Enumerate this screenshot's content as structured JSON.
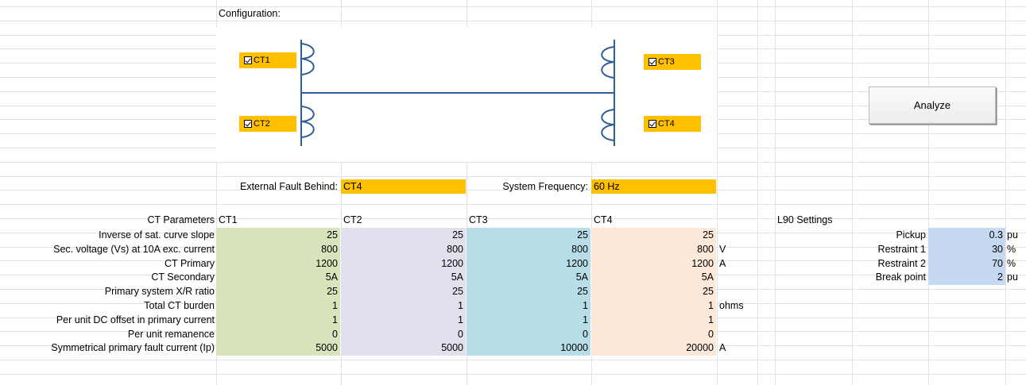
{
  "configuration_label": "Configuration:",
  "cts": [
    {
      "label": "CT1",
      "checked": true
    },
    {
      "label": "CT2",
      "checked": true
    },
    {
      "label": "CT3",
      "checked": true
    },
    {
      "label": "CT4",
      "checked": true
    }
  ],
  "analyze_label": "Analyze",
  "fault": {
    "label": "External Fault Behind:",
    "value": "CT4"
  },
  "frequency": {
    "label": "System Frequency:",
    "value": "60 Hz"
  },
  "params_header": "CT Parameters",
  "ct_columns": [
    "CT1",
    "CT2",
    "CT3",
    "CT4"
  ],
  "rows": [
    {
      "label": "Inverse of sat. curve slope",
      "values": [
        "25",
        "25",
        "25",
        "25"
      ],
      "unit": ""
    },
    {
      "label": "Sec. voltage (Vs) at 10A exc. current",
      "values": [
        "800",
        "800",
        "800",
        "800"
      ],
      "unit": "V"
    },
    {
      "label": "CT Primary",
      "values": [
        "1200",
        "1200",
        "1200",
        "1200"
      ],
      "unit": "A"
    },
    {
      "label": "CT Secondary",
      "values": [
        "5A",
        "5A",
        "5A",
        "5A"
      ],
      "unit": ""
    },
    {
      "label": "Primary system X/R ratio",
      "values": [
        "25",
        "25",
        "25",
        "25"
      ],
      "unit": ""
    },
    {
      "label": "Total CT burden",
      "values": [
        "1",
        "1",
        "1",
        "1"
      ],
      "unit": "ohms"
    },
    {
      "label": "Per unit DC offset in primary current",
      "values": [
        "1",
        "1",
        "1",
        "1"
      ],
      "unit": ""
    },
    {
      "label": "Per unit remanence",
      "values": [
        "0",
        "0",
        "0",
        "0"
      ],
      "unit": ""
    },
    {
      "label": "Symmetrical primary fault current (Ip)",
      "values": [
        "5000",
        "5000",
        "10000",
        "20000"
      ],
      "unit": "A"
    }
  ],
  "l90": {
    "header": "L90 Settings",
    "items": [
      {
        "label": "Pickup",
        "value": "0.3",
        "unit": "pu"
      },
      {
        "label": "Restraint 1",
        "value": "30",
        "unit": "%"
      },
      {
        "label": "Restraint 2",
        "value": "70",
        "unit": "%"
      },
      {
        "label": "Break point",
        "value": "2",
        "unit": "pu"
      }
    ]
  },
  "colors": {
    "highlight": "#ffc000",
    "ct1": "#d8e4bc",
    "ct2": "#e4dfec",
    "ct3": "#b7dee8",
    "ct4": "#fde9d9",
    "l90": "#c5d9f1",
    "diagram_line": "#2f5f98"
  }
}
